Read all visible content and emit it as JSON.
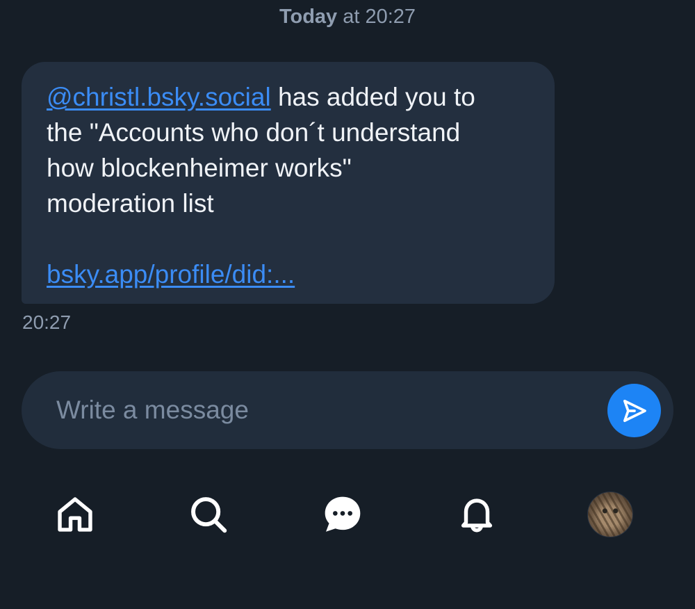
{
  "conversation": {
    "date_day": "Today",
    "date_rest": " at 20:27"
  },
  "message": {
    "mention": "@christl.bsky.social",
    "text_line1_rest": " has added you to",
    "text_line2": "the \"Accounts who don´t understand",
    "text_line3": "how blockenheimer works\"",
    "text_line4": "moderation list",
    "link": "bsky.app/profile/did:...",
    "time": "20:27"
  },
  "composer": {
    "placeholder": "Write a message",
    "value": ""
  },
  "icons": {
    "send": "send-icon",
    "home": "home-icon",
    "search": "search-icon",
    "chat": "chat-icon",
    "notifications": "bell-icon",
    "profile": "avatar"
  },
  "colors": {
    "background": "#161e27",
    "bubble": "#232f3f",
    "link": "#3b8cf5",
    "accent": "#1d84f5",
    "muted_text": "#8f9db0"
  }
}
